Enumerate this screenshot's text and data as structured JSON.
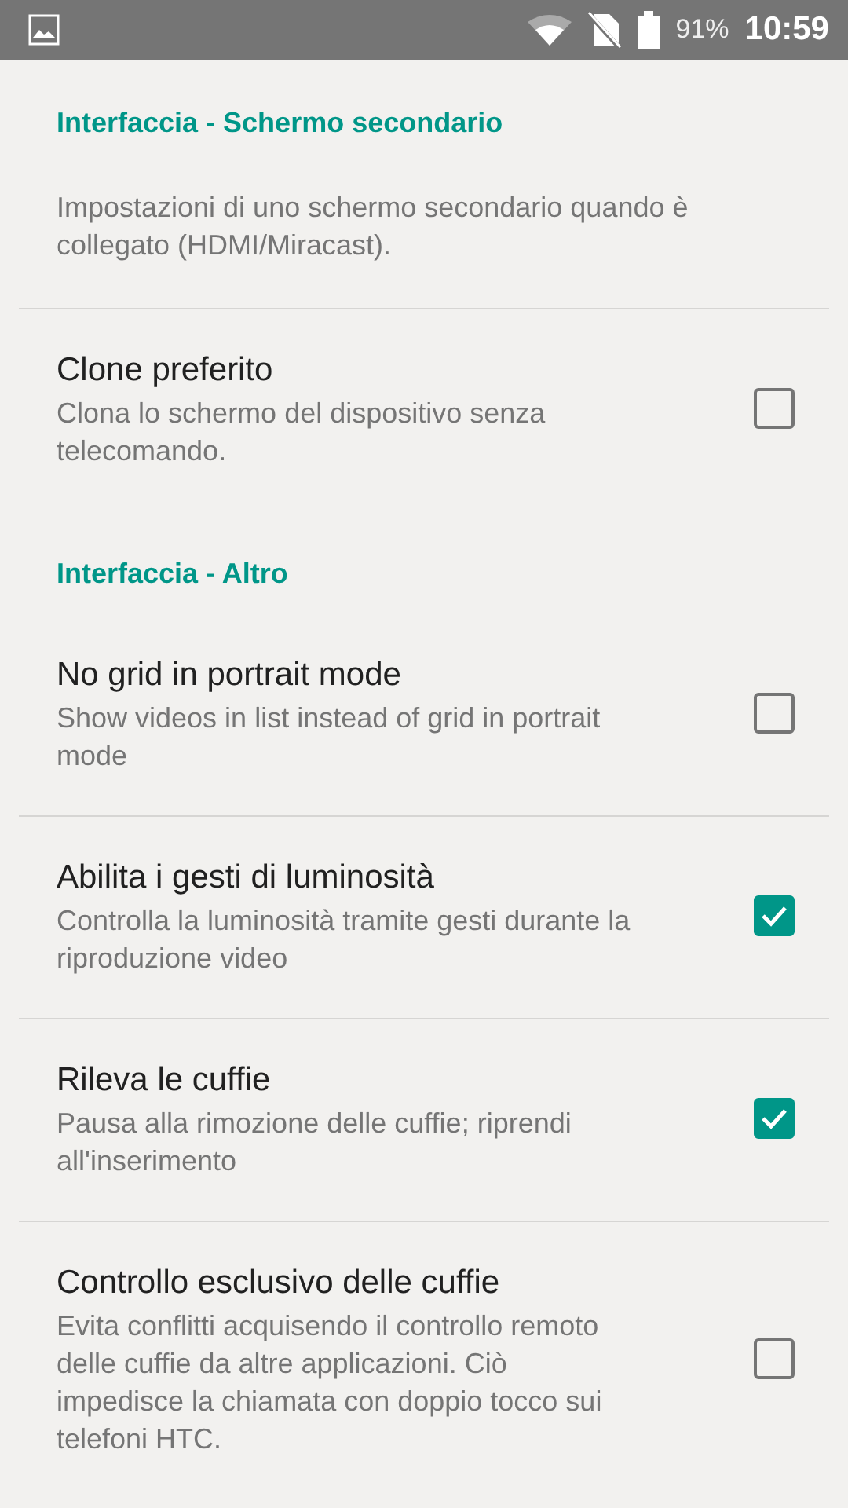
{
  "status_bar": {
    "battery": "91%",
    "time": "10:59"
  },
  "sections": [
    {
      "header": "Interfaccia - Schermo secondario",
      "description": "Impostazioni di uno schermo secondario quando è collegato (HDMI/Miracast).",
      "items": [
        {
          "title": "Clone preferito",
          "summary": "Clona lo schermo del dispositivo senza telecomando.",
          "checked": false
        }
      ]
    },
    {
      "header": "Interfaccia - Altro",
      "items": [
        {
          "title": "No grid in portrait mode",
          "summary": "Show videos in list instead of grid in portrait mode",
          "checked": false
        },
        {
          "title": "Abilita i gesti di luminosità",
          "summary": "Controlla la luminosità tramite gesti durante la riproduzione video",
          "checked": true
        },
        {
          "title": "Rileva le cuffie",
          "summary": "Pausa alla rimozione delle cuffie; riprendi all'inserimento",
          "checked": true
        },
        {
          "title": "Controllo esclusivo delle cuffie",
          "summary": "Evita conflitti acquisendo il controllo remoto delle cuffie da altre applicazioni. Ciò impedisce la chiamata con doppio tocco sui telefoni HTC.",
          "checked": false
        }
      ]
    }
  ]
}
